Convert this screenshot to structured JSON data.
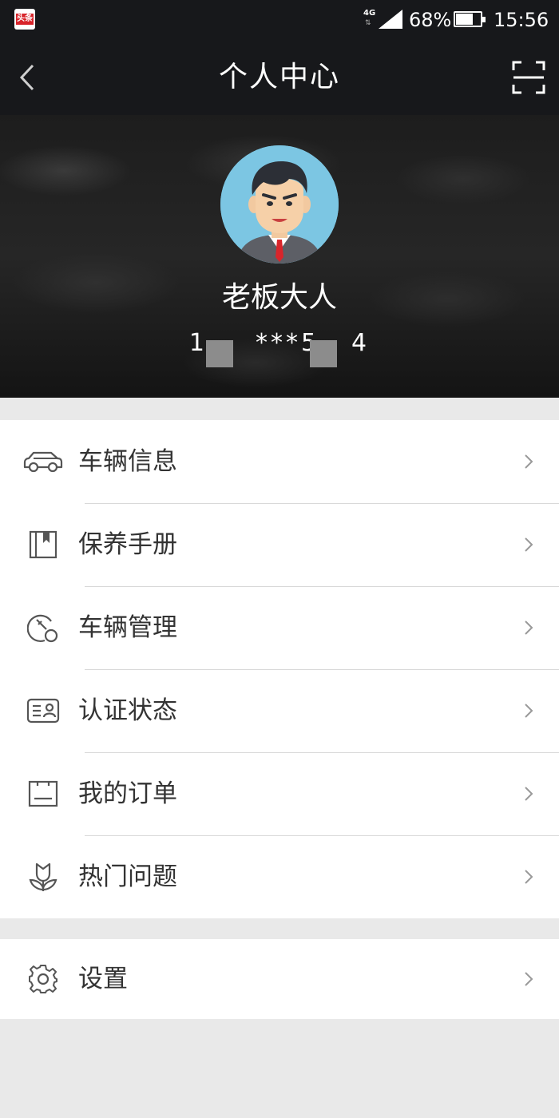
{
  "status_bar": {
    "app_badge": "头条",
    "network": "4G",
    "battery": "68%",
    "time": "15:56"
  },
  "nav": {
    "title": "个人中心"
  },
  "profile": {
    "name": "老板大人",
    "phone_left": "1",
    "phone_middle": "***5",
    "phone_right": "4"
  },
  "menu": {
    "items": [
      {
        "label": "车辆信息",
        "icon": "car-icon"
      },
      {
        "label": "保养手册",
        "icon": "manual-icon"
      },
      {
        "label": "车辆管理",
        "icon": "key-icon"
      },
      {
        "label": "认证状态",
        "icon": "id-card-icon"
      },
      {
        "label": "我的订单",
        "icon": "order-icon"
      },
      {
        "label": "热门问题",
        "icon": "flower-icon"
      }
    ],
    "settings": {
      "label": "设置",
      "icon": "gear-icon"
    }
  }
}
